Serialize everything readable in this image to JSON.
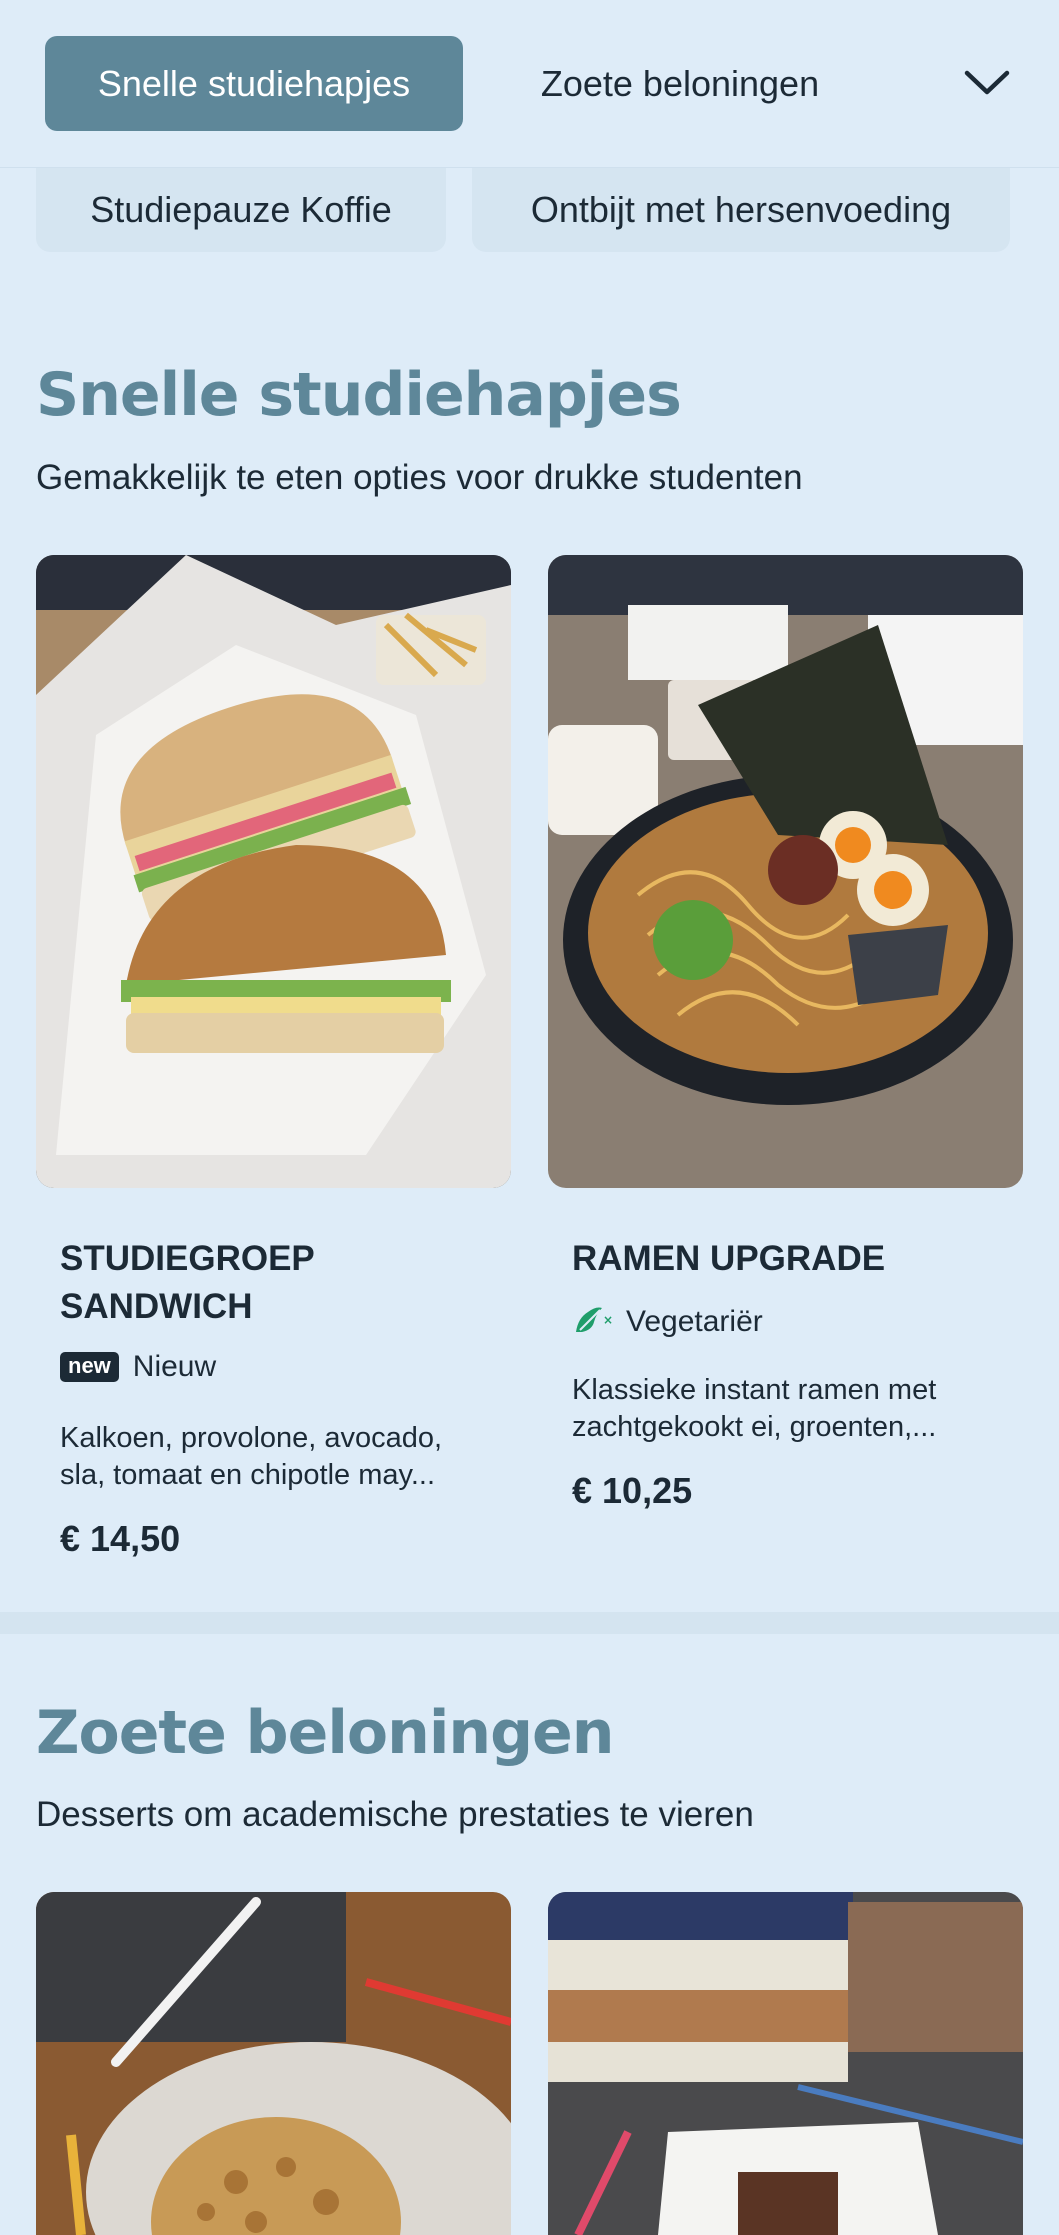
{
  "nav": {
    "tabs": [
      {
        "label": "Snelle studiehapjes",
        "active": true
      },
      {
        "label": "Zoete beloningen",
        "active": false
      }
    ],
    "more_icon": "chevron-down-icon",
    "chips": [
      "Studiepauze Koffie",
      "Ontbijt met hersenvoeding"
    ]
  },
  "sections": [
    {
      "title": "Snelle studiehapjes",
      "subtitle": "Gemakkelijk te eten opties voor drukke studenten",
      "items": [
        {
          "title_line1": "STUDIEGROEP",
          "title_line2": "SANDWICH",
          "badge": "new",
          "badge_label": "Nieuw",
          "desc_line1": "Kalkoen, provolone, avocado,",
          "desc_line2": "sla, tomaat en chipotle may...",
          "price": "€ 14,50"
        },
        {
          "title_line1": "RAMEN UPGRADE",
          "tag_icon": "vegetarian-icon",
          "tag_label": "Vegetariër",
          "desc_line1": "Klassieke instant ramen met",
          "desc_line2": "zachtgekookt ei, groenten,...",
          "price": "€ 10,25"
        }
      ]
    },
    {
      "title": "Zoete beloningen",
      "subtitle": "Desserts om academische prestaties te vieren"
    }
  ],
  "colors": {
    "background": "#deecf8",
    "accent": "#5e8799",
    "text": "#1c2a36",
    "veg_icon": "#1f9e6b"
  }
}
